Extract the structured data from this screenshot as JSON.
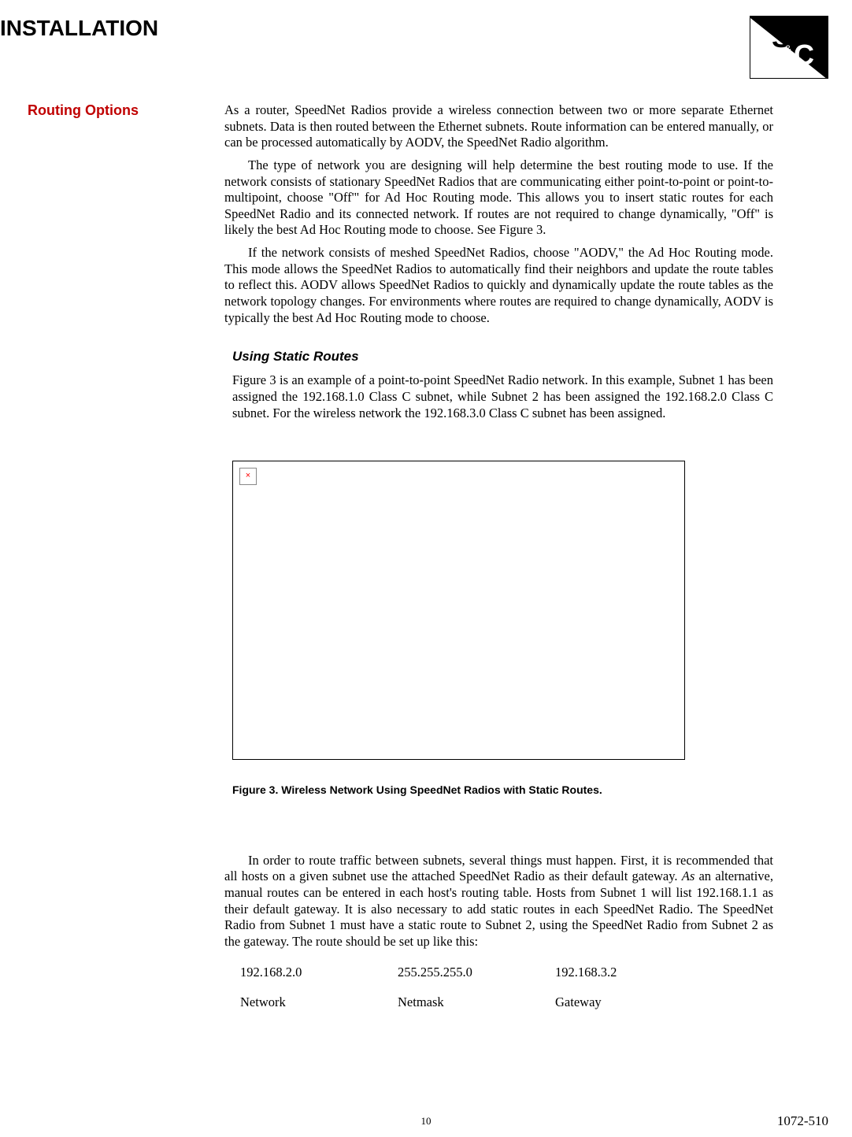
{
  "header": {
    "title": "INSTALLATION",
    "logo_alt": "S&C"
  },
  "sidebar": {
    "heading": "Routing Options"
  },
  "body": {
    "p1": "As a router, SpeedNet Radios provide a wireless connection between two or more separate Ethernet subnets. Data is then routed between the Ethernet subnets. Route information can be entered manually, or can be processed automatically by AODV, the SpeedNet Radio algorithm.",
    "p2": "The type of network you are designing will help determine the best routing mode to use. If the network consists of stationary SpeedNet Radios that are communicating either point-to-point or point-to-multipoint, choose \"Off'\" for Ad Hoc Routing mode. This allows you to insert static routes for each SpeedNet Radio and its connected network. If routes are not required to change dynamically, \"Off\" is likely the best Ad Hoc Routing mode to choose. See Figure 3.",
    "p3": "If the network consists of meshed SpeedNet Radios, choose \"AODV,\" the Ad Hoc Routing mode. This mode allows the SpeedNet Radios to automatically find their neighbors and update the route tables to reflect this. AODV allows SpeedNet Radios to quickly and dynamically update the route tables as the network topology changes. For environments where routes are required to change dynamically, AODV is typically the best Ad Hoc Routing mode to choose.",
    "subheading": "Using Static Routes",
    "p4": "Figure 3 is an example of a point-to-point SpeedNet Radio network. In this example, Subnet 1 has been assigned the 192.168.1.0 Class C subnet, while Subnet 2 has been assigned the 192.168.2.0 Class C subnet. For the wireless network the 192.168.3.0 Class C subnet has been assigned.",
    "figure_caption": "Figure 3. Wireless Network Using SpeedNet Radios with Static Routes.",
    "p5_prefix": "In order to route traffic between subnets, several things must happen. First, it is recommended that all hosts on a given subnet use the attached SpeedNet Radio as their default gateway. ",
    "p5_italic": "As",
    "p5_suffix": " an alternative, manual routes can be entered in each host's routing table. Hosts from Subnet 1 will list 192.168.1.1 as their default gateway. It is also necessary to add static routes in each SpeedNet Radio. The SpeedNet Radio from Subnet 1 must have a static route to Subnet 2, using the SpeedNet Radio from Subnet 2 as the gateway. The route should be set up like this:"
  },
  "route_table": {
    "row1": {
      "c1": "192.168.2.0",
      "c2": "255.255.255.0",
      "c3": "192.168.3.2"
    },
    "row2": {
      "c1": "Network",
      "c2": "Netmask",
      "c3": "Gateway"
    }
  },
  "footer": {
    "page_number": "10",
    "doc_id": "1072-510"
  },
  "broken_img_glyph": "×"
}
